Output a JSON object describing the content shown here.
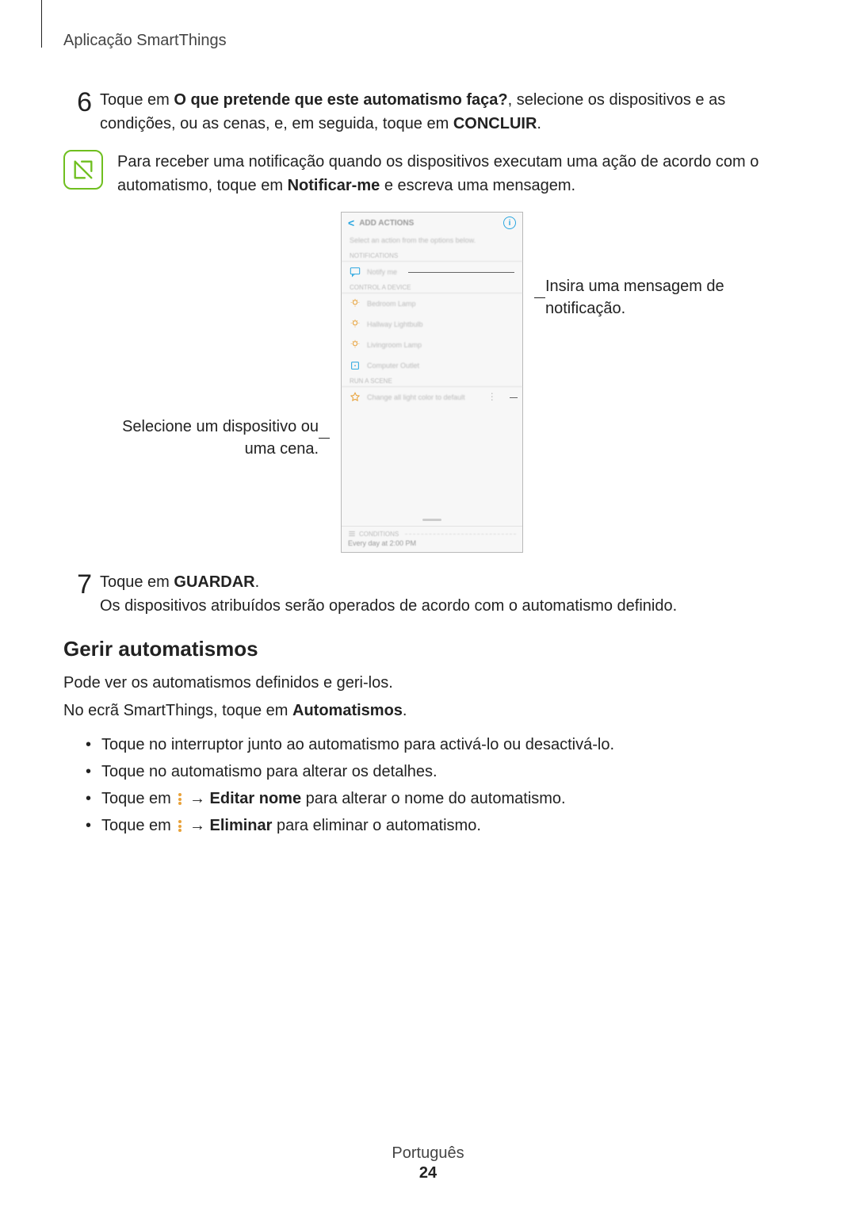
{
  "header": "Aplicação SmartThings",
  "step6": {
    "num": "6",
    "pre": "Toque em ",
    "bold1": "O que pretende que este automatismo faça?",
    "mid": ", selecione os dispositivos e as condições, ou as cenas, e, em seguida, toque em ",
    "bold2": "CONCLUIR",
    "post": "."
  },
  "note": {
    "pre": "Para receber uma notificação quando os dispositivos executam uma ação de acordo com o automatismo, toque em ",
    "bold": "Notificar-me",
    "post": " e escreva uma mensagem."
  },
  "callout_left": "Selecione um dispositivo ou uma cena.",
  "callout_right": "Insira uma mensagem de notificação.",
  "phone": {
    "title": "ADD ACTIONS",
    "sub": "Select an action from the options below.",
    "sec_notif": "NOTIFICATIONS",
    "notify": "Notify me",
    "sec_control": "CONTROL A DEVICE",
    "dev1": "Bedroom Lamp",
    "dev2": "Hallway Lightbulb",
    "dev3": "Livingroom Lamp",
    "dev4": "Computer Outlet",
    "sec_scene": "RUN A SCENE",
    "scene": "Change all light color to default",
    "cond_lbl": "CONDITIONS",
    "time": "Every day at 2:00 PM"
  },
  "step7": {
    "num": "7",
    "pre": "Toque em ",
    "bold": "GUARDAR",
    "post1": ".",
    "line2": "Os dispositivos atribuídos serão operados de acordo com o automatismo definido."
  },
  "h2": "Gerir automatismos",
  "p1": "Pode ver os automatismos definidos e geri-los.",
  "p2_pre": "No ecrã SmartThings, toque em ",
  "p2_bold": "Automatismos",
  "p2_post": ".",
  "bul1": "Toque no interruptor junto ao automatismo para activá-lo ou desactivá-lo.",
  "bul2": "Toque no automatismo para alterar os detalhes.",
  "bul3_pre": "Toque em ",
  "bul3_arrow": " → ",
  "bul3_bold": "Editar nome",
  "bul3_post": " para alterar o nome do automatismo.",
  "bul4_pre": "Toque em ",
  "bul4_arrow": " → ",
  "bul4_bold": "Eliminar",
  "bul4_post": " para eliminar o automatismo.",
  "footer_lang": "Português",
  "footer_page": "24"
}
